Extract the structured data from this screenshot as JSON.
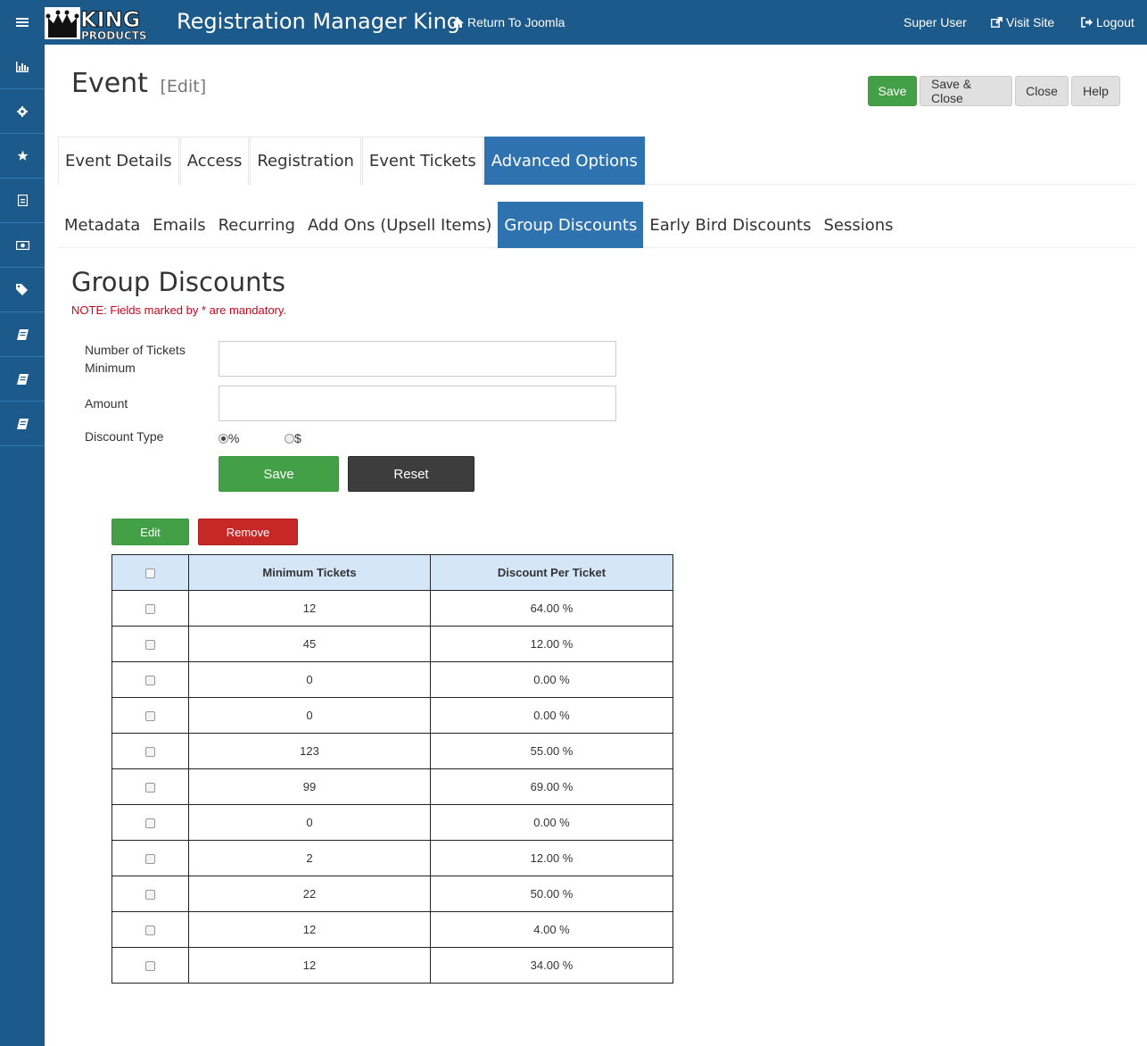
{
  "app": {
    "title": "Registration Manager King",
    "logo_text_top": "KING",
    "logo_text_bottom": "PRODUCTS"
  },
  "topnav": {
    "return": "Return To Joomla",
    "user": "Super User",
    "visit": "Visit Site",
    "logout": "Logout"
  },
  "sidebar": {
    "items": [
      "chart-icon",
      "gear-icon",
      "star-icon",
      "document-icon",
      "money-icon",
      "tags-icon",
      "book-icon",
      "book-icon",
      "book-icon"
    ]
  },
  "page": {
    "title": "Event",
    "edit_tag": "[Edit]"
  },
  "toolbar": {
    "save": "Save",
    "save_close": "Save & Close",
    "close": "Close",
    "help": "Help"
  },
  "tabs": [
    "Event Details",
    "Access",
    "Registration",
    "Event Tickets",
    "Advanced Options"
  ],
  "subtabs": [
    "Metadata",
    "Emails",
    "Recurring",
    "Add Ons (Upsell Items)",
    "Group Discounts",
    "Early Bird Discounts",
    "Sessions"
  ],
  "section": {
    "title": "Group Discounts",
    "note": "NOTE: Fields marked by * are mandatory."
  },
  "form": {
    "min_tickets_label_1": "Number of Tickets",
    "min_tickets_label_2": "Minimum",
    "min_tickets_value": "",
    "amount_label": "Amount",
    "amount_value": "",
    "discount_type_label": "Discount Type",
    "opt_percent": "%",
    "opt_dollar": "$",
    "save": "Save",
    "reset": "Reset"
  },
  "list_actions": {
    "edit": "Edit",
    "remove": "Remove"
  },
  "table": {
    "headers": [
      "Minimum Tickets",
      "Discount Per Ticket"
    ],
    "rows": [
      [
        "12",
        "64.00 %"
      ],
      [
        "45",
        "12.00 %"
      ],
      [
        "0",
        "0.00 %"
      ],
      [
        "0",
        "0.00 %"
      ],
      [
        "123",
        "55.00 %"
      ],
      [
        "99",
        "69.00 %"
      ],
      [
        "0",
        "0.00 %"
      ],
      [
        "2",
        "12.00 %"
      ],
      [
        "22",
        "50.00 %"
      ],
      [
        "12",
        "4.00 %"
      ],
      [
        "12",
        "34.00 %"
      ]
    ]
  },
  "colors": {
    "brand": "#1b5a8a",
    "active_tab": "#2f72b0",
    "success": "#43a047",
    "danger": "#c62828",
    "dark": "#3d3d3d",
    "note": "#d0021b"
  }
}
